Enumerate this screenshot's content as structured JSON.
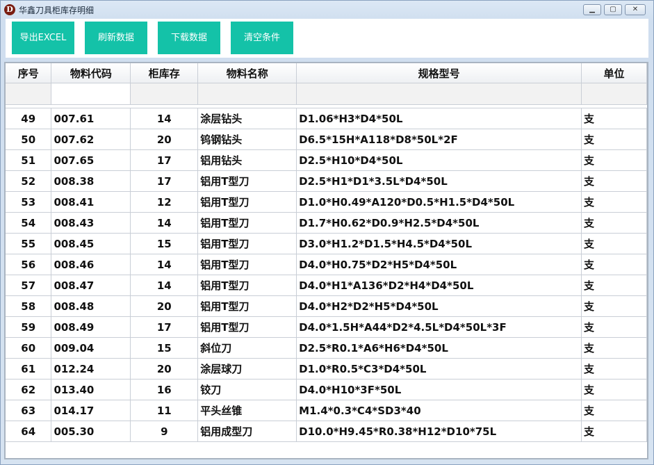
{
  "window": {
    "app_icon_letter": "D",
    "title": "华鑫刀具柜库存明细",
    "min_glyph": "▁",
    "max_glyph": "▢",
    "close_glyph": "✕"
  },
  "toolbar": {
    "buttons": [
      "导出EXCEL",
      "刷新数据",
      "下载数据",
      "清空条件"
    ]
  },
  "table": {
    "headers": [
      "序号",
      "物料代码",
      "柜库存",
      "物料名称",
      "规格型号",
      "单位"
    ],
    "rows": [
      [
        "49",
        "007.61",
        "14",
        "涂层钻头",
        "D1.06*H3*D4*50L",
        "支"
      ],
      [
        "50",
        "007.62",
        "20",
        "钨钢钻头",
        "D6.5*15H*A118*D8*50L*2F",
        "支"
      ],
      [
        "51",
        "007.65",
        "17",
        "铝用钻头",
        "D2.5*H10*D4*50L",
        "支"
      ],
      [
        "52",
        "008.38",
        "17",
        "铝用T型刀",
        "D2.5*H1*D1*3.5L*D4*50L",
        "支"
      ],
      [
        "53",
        "008.41",
        "12",
        "铝用T型刀",
        "D1.0*H0.49*A120*D0.5*H1.5*D4*50L",
        "支"
      ],
      [
        "54",
        "008.43",
        "14",
        "铝用T型刀",
        "D1.7*H0.62*D0.9*H2.5*D4*50L",
        "支"
      ],
      [
        "55",
        "008.45",
        "15",
        "铝用T型刀",
        "D3.0*H1.2*D1.5*H4.5*D4*50L",
        "支"
      ],
      [
        "56",
        "008.46",
        "14",
        "铝用T型刀",
        "D4.0*H0.75*D2*H5*D4*50L",
        "支"
      ],
      [
        "57",
        "008.47",
        "14",
        "铝用T型刀",
        "D4.0*H1*A136*D2*H4*D4*50L",
        "支"
      ],
      [
        "58",
        "008.48",
        "20",
        "铝用T型刀",
        "D4.0*H2*D2*H5*D4*50L",
        "支"
      ],
      [
        "59",
        "008.49",
        "17",
        "铝用T型刀",
        "D4.0*1.5H*A44*D2*4.5L*D4*50L*3F",
        "支"
      ],
      [
        "60",
        "009.04",
        "15",
        "斜位刀",
        "D2.5*R0.1*A6*H6*D4*50L",
        "支"
      ],
      [
        "61",
        "012.24",
        "20",
        "涂层球刀",
        "D1.0*R0.5*C3*D4*50L",
        "支"
      ],
      [
        "62",
        "013.40",
        "16",
        "铰刀",
        "D4.0*H10*3F*50L",
        "支"
      ],
      [
        "63",
        "014.17",
        "11",
        "平头丝锥",
        "M1.4*0.3*C4*SD3*40",
        "支"
      ],
      [
        "64",
        "005.30",
        "9",
        "铝用成型刀",
        "D10.0*H9.45*R0.38*H12*D10*75L",
        "支"
      ]
    ]
  }
}
